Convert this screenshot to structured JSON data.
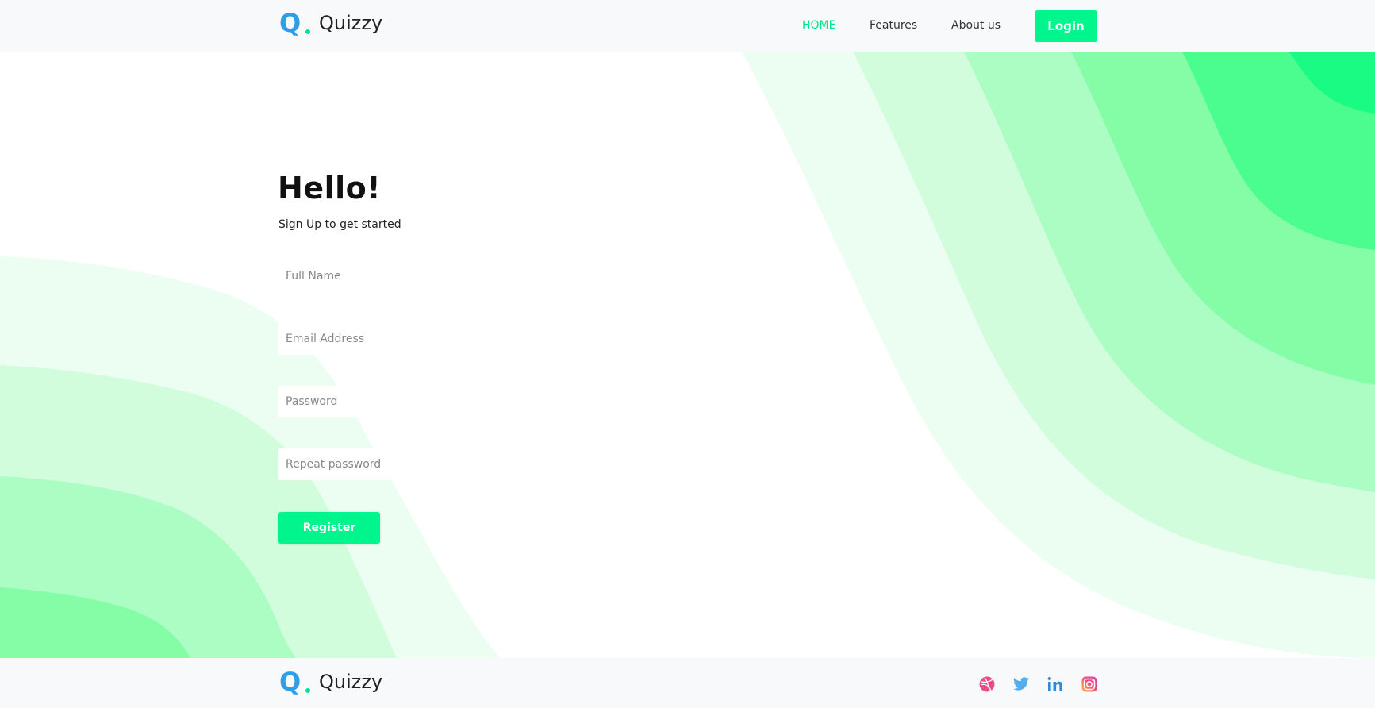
{
  "header": {
    "brand": "Quizzy",
    "logo_letter": "Q",
    "nav": [
      {
        "label": "HOME",
        "active": true
      },
      {
        "label": "Features",
        "active": false
      },
      {
        "label": "About us",
        "active": false
      }
    ],
    "login_label": "Login"
  },
  "form": {
    "title": "Hello!",
    "subtitle": "Sign Up to get started",
    "fields": [
      {
        "placeholder": "Full Name",
        "value": ""
      },
      {
        "placeholder": "Email Address",
        "value": ""
      },
      {
        "placeholder": "Password",
        "value": ""
      },
      {
        "placeholder": "Repeat password",
        "value": ""
      }
    ],
    "submit_label": "Register"
  },
  "footer": {
    "brand": "Quizzy",
    "logo_letter": "Q",
    "social_icons": [
      "dribbble-icon",
      "twitter-icon",
      "linkedin-icon",
      "instagram-icon"
    ]
  },
  "colors": {
    "accent": "#00f58d",
    "logo_blue": "#2d9ee8",
    "logo_dot": "#00e58a",
    "bar_bg": "#f8f9fa",
    "wave_1": "#ebfef1",
    "wave_2": "#d1fddd",
    "wave_3": "#abfdc4",
    "wave_4": "#85fda7",
    "wave_5": "#4afd8e",
    "wave_6": "#1afb83"
  }
}
